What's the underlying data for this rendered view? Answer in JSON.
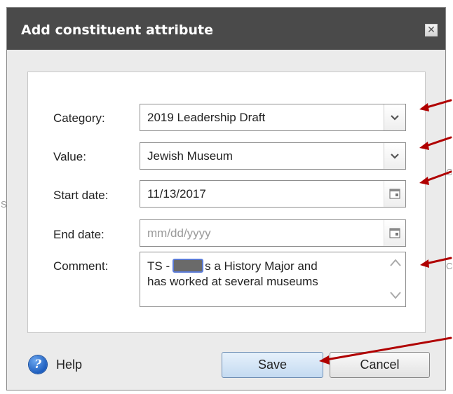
{
  "background_fragments": [
    "S",
    "C",
    "C"
  ],
  "dialog": {
    "title": "Add constituent attribute",
    "close_icon": "close-icon",
    "fields": {
      "category": {
        "label": "Category:",
        "value": "2019 Leadership Draft"
      },
      "value": {
        "label": "Value:",
        "value": "Jewish Museum"
      },
      "start_date": {
        "label": "Start date:",
        "value": "11/13/2017"
      },
      "end_date": {
        "label": "End date:",
        "value": "",
        "placeholder": "mm/dd/yyyy"
      },
      "comment": {
        "label": "Comment:",
        "line1_prefix": "TS -",
        "line1_suffix": "s a History Major and",
        "line2": "has worked at several museums"
      }
    },
    "help_label": "Help",
    "save_label": "Save",
    "cancel_label": "Cancel"
  },
  "colors": {
    "title_bar": "#4a4a4a",
    "dialog_bg": "#ebebeb",
    "annotation_arrow": "#b00000",
    "redaction_border": "#5b7bd6"
  },
  "icons": [
    "close-icon",
    "dropdown-chevron-icon",
    "calendar-icon",
    "scroll-up-icon",
    "scroll-down-icon",
    "help-icon",
    "annotation-arrow-icon"
  ]
}
